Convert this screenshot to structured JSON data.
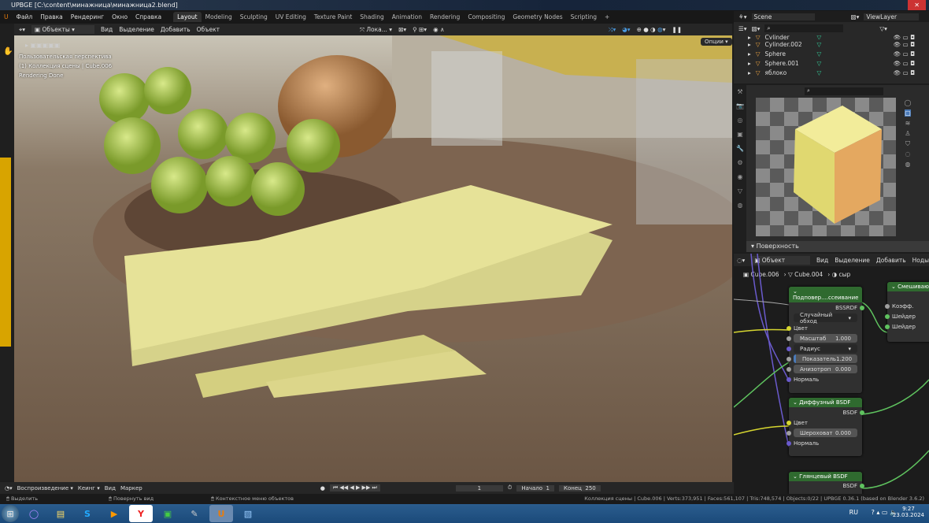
{
  "title": "UPBGE [C:\\content\\минажница\\минажница2.blend]",
  "menu": [
    "Файл",
    "Правка",
    "Рендеринг",
    "Окно",
    "Справка"
  ],
  "workspaces": [
    "Layout",
    "Modeling",
    "Sculpting",
    "UV Editing",
    "Texture Paint",
    "Shading",
    "Animation",
    "Rendering",
    "Compositing",
    "Geometry Nodes",
    "Scripting",
    "+"
  ],
  "active_workspace": "Layout",
  "viewport": {
    "mode": "Объекты",
    "menus": [
      "Вид",
      "Выделение",
      "Добавить",
      "Объект"
    ],
    "transform": "Лока...",
    "options": "Опции",
    "overlay": [
      "Пользовательская перспектива",
      "(1) Коллекция сцены | Cube.006",
      "Rendering Done"
    ]
  },
  "outliner": {
    "scene": "Scene",
    "view_layer": "ViewLayer",
    "items": [
      "Cylinder",
      "Cylinder.002",
      "Sphere",
      "Sphere.001",
      "яблоко"
    ]
  },
  "properties": {
    "panel": "Поверхность"
  },
  "node_editor": {
    "type": "Объект",
    "menus": [
      "Вид",
      "Выделение",
      "Добавить",
      "Ноды"
    ],
    "breadcrumb": [
      "Cube.006",
      "Cube.004",
      "сыр"
    ],
    "sss": {
      "title": "Подповер....ссеивание",
      "out": "BSSRDF",
      "method": "Случайный обход",
      "color": "Цвет",
      "scale_label": "Масштаб",
      "scale": "1.000",
      "radius": "Радиус",
      "ior_label": "Показатель",
      "ior": "1.200",
      "aniso_label": "Анизотроп",
      "aniso": "0.000",
      "normal": "Нормаль"
    },
    "diffuse": {
      "title": "Диффузный BSDF",
      "out": "BSDF",
      "color": "Цвет",
      "rough_label": "Шероховат",
      "rough": "0.000",
      "normal": "Нормаль"
    },
    "glossy": {
      "title": "Глянцевый BSDF",
      "out": "BSDF"
    },
    "mix": {
      "title": "Смешиваю...",
      "fac": "Коэфф.",
      "shader1": "Шейдер",
      "shader2": "Шейдер"
    }
  },
  "timeline": {
    "playback": "Воспроизведение",
    "keying": "Кеинг",
    "view": "Вид",
    "marker": "Маркер",
    "frame": "1",
    "start_label": "Начало",
    "start": "1",
    "end_label": "Конец",
    "end": "250"
  },
  "status": {
    "select": "Выделить",
    "rotate": "Повернуть вид",
    "context": "Контекстное меню объектов",
    "stats": "Коллекция сцены | Cube.006 | Verts:373,951 | Faces:561,107 | Tris:748,574 | Objects:0/22 | UPBGE 0.36.1 (based on Blender 3.6.2)"
  },
  "taskbar": {
    "lang": "RU",
    "time": "9:27",
    "date": "23.03.2024"
  }
}
